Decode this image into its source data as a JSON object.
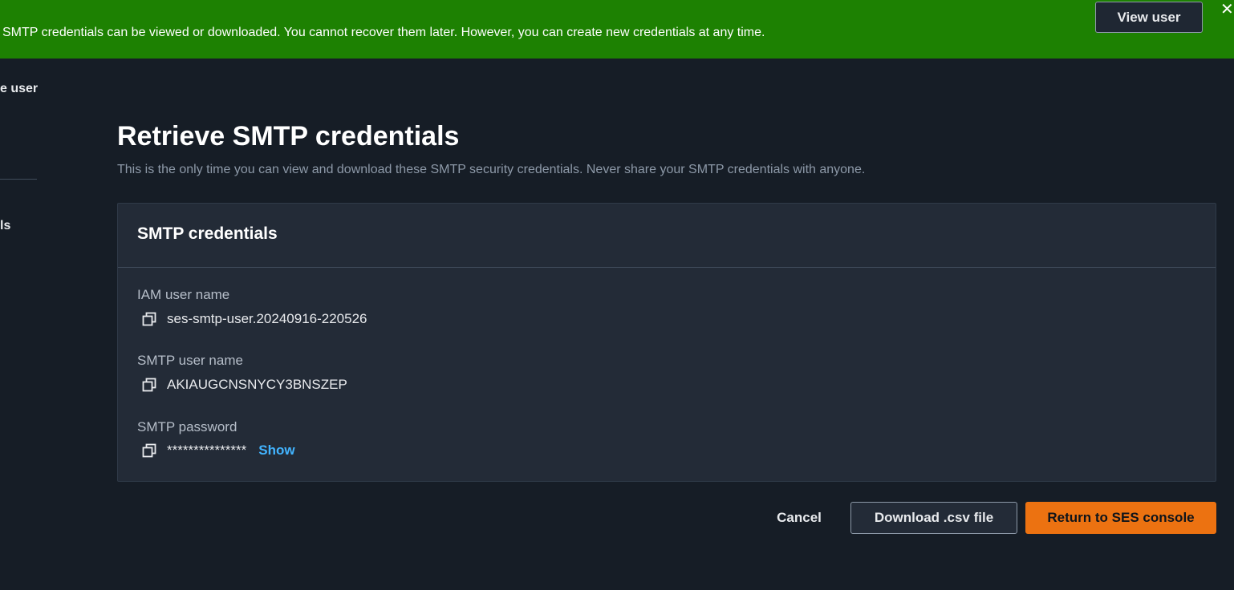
{
  "banner": {
    "message": "SMTP credentials can be viewed or downloaded. You cannot recover them later. However, you can create new credentials at any time.",
    "view_user_label": "View user",
    "close_glyph": "✕",
    "color": "#1d8102"
  },
  "sidebar": {
    "partial_item_1": "e user",
    "partial_item_2": "ls"
  },
  "page": {
    "title": "Retrieve SMTP credentials",
    "description": "This is the only time you can view and download these SMTP security credentials. Never share your SMTP credentials with anyone."
  },
  "credentials": {
    "title": "SMTP credentials",
    "fields": [
      {
        "label": "IAM user name",
        "value": "ses-smtp-user.20240916-220526",
        "icon": "copy-icon"
      },
      {
        "label": "SMTP user name",
        "value": "AKIAUGCNSNYCY3BNSZEP",
        "icon": "copy-icon"
      },
      {
        "label": "SMTP password",
        "value": "***************",
        "icon": "copy-icon",
        "action": "Show"
      }
    ]
  },
  "actions": {
    "cancel_label": "Cancel",
    "download_label": "Download .csv file",
    "return_label": "Return to SES console",
    "primary_color": "#ec7211"
  }
}
